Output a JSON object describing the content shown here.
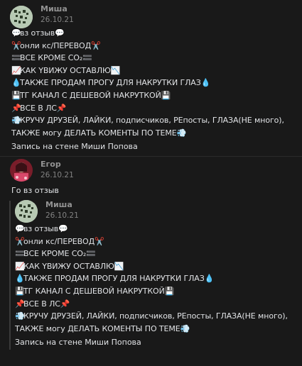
{
  "post1": {
    "author": "Миша",
    "date": "26.10.21",
    "lines": [
      {
        "pre": "💬",
        "text": "вз отзыв",
        "post": "💬"
      },
      {
        "pre": "✂️",
        "text": "онли кс/ПЕРЕВОД",
        "post": "✂️"
      },
      {
        "pre": "🟰",
        "text": "ВСЕ КРОМЕ CO₂",
        "post": "🟰"
      },
      {
        "pre": "📈",
        "text": "КАК YВИЖУ ОСТАВЛЮ",
        "post": "📉"
      },
      {
        "pre": "💧",
        "text": "ТАКЖЕ ПРОДАМ ПРОГУ ДЛЯ НАКРУТКИ ГЛАЗ",
        "post": "💧"
      },
      {
        "pre": "💾",
        "text": "ТГ КАНАЛ С ДЕШЕВОЙ НАКРУТКОЙ",
        "post": "💾"
      },
      {
        "pre": "📌",
        "text": "ВСЕ В ЛС",
        "post": "📌"
      },
      {
        "pre": "💨",
        "text": "КРУЧУ ДРУЗЕЙ, ЛАЙКИ, подписчиков, РЕпосты, ГЛАЗА(НЕ много), ТАКЖЕ могу ДЕЛАТЬ КОМЕНТЫ ПО ТЕМЕ",
        "post": "💨"
      }
    ],
    "wall_link": "Запись на стене Миши Попова"
  },
  "post2": {
    "author": "Егор",
    "date": "26.10.21",
    "text": "Го вз отзыв",
    "repost": {
      "author": "Миша",
      "date": "26.10.21",
      "lines": [
        {
          "pre": "💬",
          "text": "вз отзыв",
          "post": "💬"
        },
        {
          "pre": "✂️",
          "text": "онли кс/ПЕРЕВОД",
          "post": "✂️"
        },
        {
          "pre": "🟰",
          "text": "ВСЕ КРОМЕ CO₂",
          "post": "🟰"
        },
        {
          "pre": "📈",
          "text": "КАК YВИЖУ ОСТАВЛЮ",
          "post": "📉"
        },
        {
          "pre": "💧",
          "text": "ТАКЖЕ ПРОДАМ ПРОГУ ДЛЯ НАКРУТКИ ГЛАЗ",
          "post": "💧"
        },
        {
          "pre": "💾",
          "text": "ТГ КАНАЛ С ДЕШЕВОЙ НАКРУТКОЙ",
          "post": "💾"
        },
        {
          "pre": "📌",
          "text": "ВСЕ В ЛС",
          "post": "📌"
        },
        {
          "pre": "💨",
          "text": "КРУЧУ ДРУЗЕЙ, ЛАЙКИ, подписчиков, РЕпосты, ГЛАЗА(НЕ много), ТАКЖЕ могу ДЕЛАТЬ КОМЕНТЫ ПО ТЕМЕ",
          "post": "💨"
        }
      ],
      "wall_link": "Запись на стене Миши Попова"
    }
  }
}
